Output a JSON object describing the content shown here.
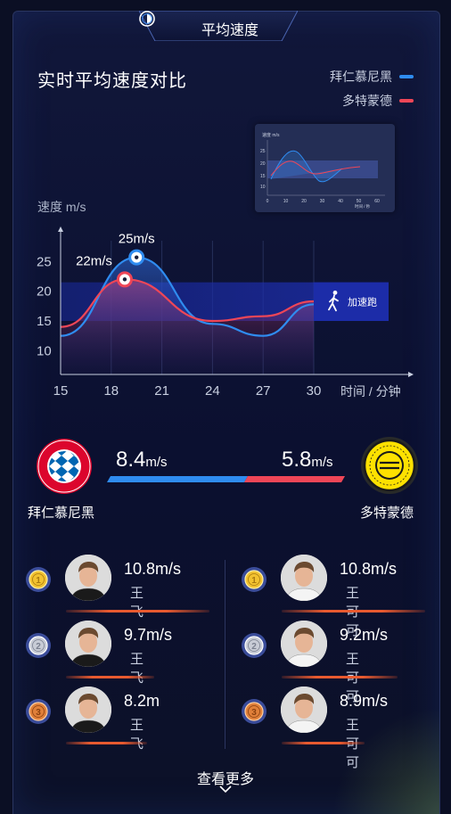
{
  "header": {
    "tab_title": "平均速度",
    "tab_icon": "half-circle-icon"
  },
  "card": {
    "title": "实时平均速度对比"
  },
  "legend": [
    {
      "label": "拜仁慕尼黑",
      "color": "#2f8cf0"
    },
    {
      "label": "多特蒙德",
      "color": "#ef4657"
    }
  ],
  "chart_data": {
    "type": "line",
    "ylabel": "速度 m/s",
    "xlabel": "时间 / 分钟",
    "x_ticks": [
      "15",
      "18",
      "21",
      "24",
      "27",
      "30"
    ],
    "y_ticks": [
      "10",
      "15",
      "20",
      "25"
    ],
    "ylim": [
      6,
      30
    ],
    "xlim": [
      15,
      30
    ],
    "series": [
      {
        "name": "拜仁慕尼黑",
        "color": "#2f8cf0",
        "x": [
          15,
          19.5,
          24,
          27,
          30
        ],
        "y": [
          12.5,
          25.7,
          14.5,
          12.5,
          17.8
        ]
      },
      {
        "name": "多特蒙德",
        "color": "#ef4657",
        "x": [
          15,
          18.8,
          24,
          27,
          30
        ],
        "y": [
          14,
          22,
          15,
          15.8,
          18.3
        ]
      }
    ],
    "annotations": [
      {
        "text": "25m/s",
        "x": 19.5,
        "y": 25.7,
        "series": "拜仁慕尼黑"
      },
      {
        "text": "22m/s",
        "x": 18.8,
        "y": 22,
        "series": "多特蒙德"
      }
    ],
    "band": {
      "y_from": 15,
      "y_to": 21.5,
      "label": "加速跑",
      "icon": "runner-icon"
    }
  },
  "mini_chart": {
    "ylabel": "速度 m/s",
    "xlabel": "时间 / 秒",
    "y_ticks": [
      "10",
      "15",
      "20",
      "25"
    ],
    "x_ticks": [
      "0",
      "10",
      "20",
      "30",
      "40",
      "50",
      "60"
    ]
  },
  "comparison": {
    "home": {
      "name": "拜仁慕尼黑",
      "speed": "8.4",
      "unit": "m/s",
      "color": "#2f8cf0"
    },
    "away": {
      "name": "多特蒙德",
      "speed": "5.8",
      "unit": "m/s",
      "color": "#ef4657"
    },
    "home_ratio": 0.59
  },
  "ranking": {
    "left": [
      {
        "rank": "1",
        "speed": "10.8m/s",
        "name": "王飞",
        "medal": "gold"
      },
      {
        "rank": "2",
        "speed": "9.7m/s",
        "name": "王飞",
        "medal": "silver"
      },
      {
        "rank": "3",
        "speed": "8.2m",
        "name": "王飞",
        "medal": "bronze"
      }
    ],
    "right": [
      {
        "rank": "1",
        "speed": "10.8m/s",
        "name": "王可可",
        "medal": "gold"
      },
      {
        "rank": "2",
        "speed": "9.2m/s",
        "name": "王可可",
        "medal": "silver"
      },
      {
        "rank": "3",
        "speed": "8.9m/s",
        "name": "王可可",
        "medal": "bronze"
      }
    ]
  },
  "footer": {
    "more_label": "查看更多",
    "more_icon": "chevron-down-icon"
  }
}
